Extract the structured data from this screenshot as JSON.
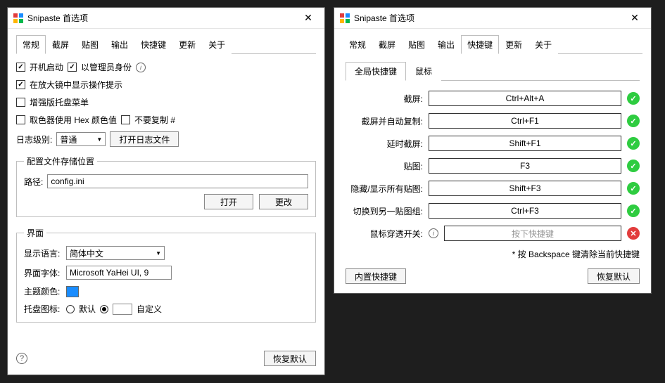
{
  "left": {
    "title": "Snipaste 首选项",
    "tabs": [
      "常规",
      "截屏",
      "贴图",
      "输出",
      "快捷键",
      "更新",
      "关于"
    ],
    "active_tab": "常规",
    "startup_label": "开机启动",
    "admin_label": "以管理员身份",
    "magnifier_tip_label": "在放大镜中显示操作提示",
    "enhanced_tray_label": "增强版托盘菜单",
    "hex_color_label": "取色器使用 Hex 颜色值",
    "no_copy_hash_label": "不要复制 #",
    "log_level_label": "日志级别:",
    "log_level_value": "普通",
    "open_log_button": "打开日志文件",
    "config_group_title": "配置文件存储位置",
    "path_label": "路径:",
    "path_value": "config.ini",
    "open_button": "打开",
    "change_button": "更改",
    "ui_group_title": "界面",
    "display_lang_label": "显示语言:",
    "display_lang_value": "简体中文",
    "ui_font_label": "界面字体:",
    "ui_font_value": "Microsoft YaHei UI, 9",
    "theme_color_label": "主题颜色:",
    "theme_color_value": "#1a8cff",
    "tray_icon_label": "托盘图标:",
    "tray_default_label": "默认",
    "tray_custom_label": "自定义",
    "restore_defaults": "恢复默认"
  },
  "right": {
    "title": "Snipaste 首选项",
    "tabs": [
      "常规",
      "截屏",
      "贴图",
      "输出",
      "快捷键",
      "更新",
      "关于"
    ],
    "active_tab": "快捷键",
    "subtabs": [
      "全局快捷键",
      "鼠标"
    ],
    "active_subtab": "全局快捷键",
    "rows": [
      {
        "label": "截屏:",
        "value": "Ctrl+Alt+A",
        "status": "ok"
      },
      {
        "label": "截屏并自动复制:",
        "value": "Ctrl+F1",
        "status": "ok"
      },
      {
        "label": "延时截屏:",
        "value": "Shift+F1",
        "status": "ok"
      },
      {
        "label": "贴图:",
        "value": "F3",
        "status": "ok"
      },
      {
        "label": "隐藏/显示所有贴图:",
        "value": "Shift+F3",
        "status": "ok"
      },
      {
        "label": "切换到另一贴图组:",
        "value": "Ctrl+F3",
        "status": "ok"
      }
    ],
    "mouse_row_label": "鼠标穿透开关:",
    "mouse_row_placeholder": "按下快捷键",
    "note": "* 按 Backspace 键清除当前快捷键",
    "builtin_button": "内置快捷键",
    "restore_defaults": "恢复默认"
  }
}
